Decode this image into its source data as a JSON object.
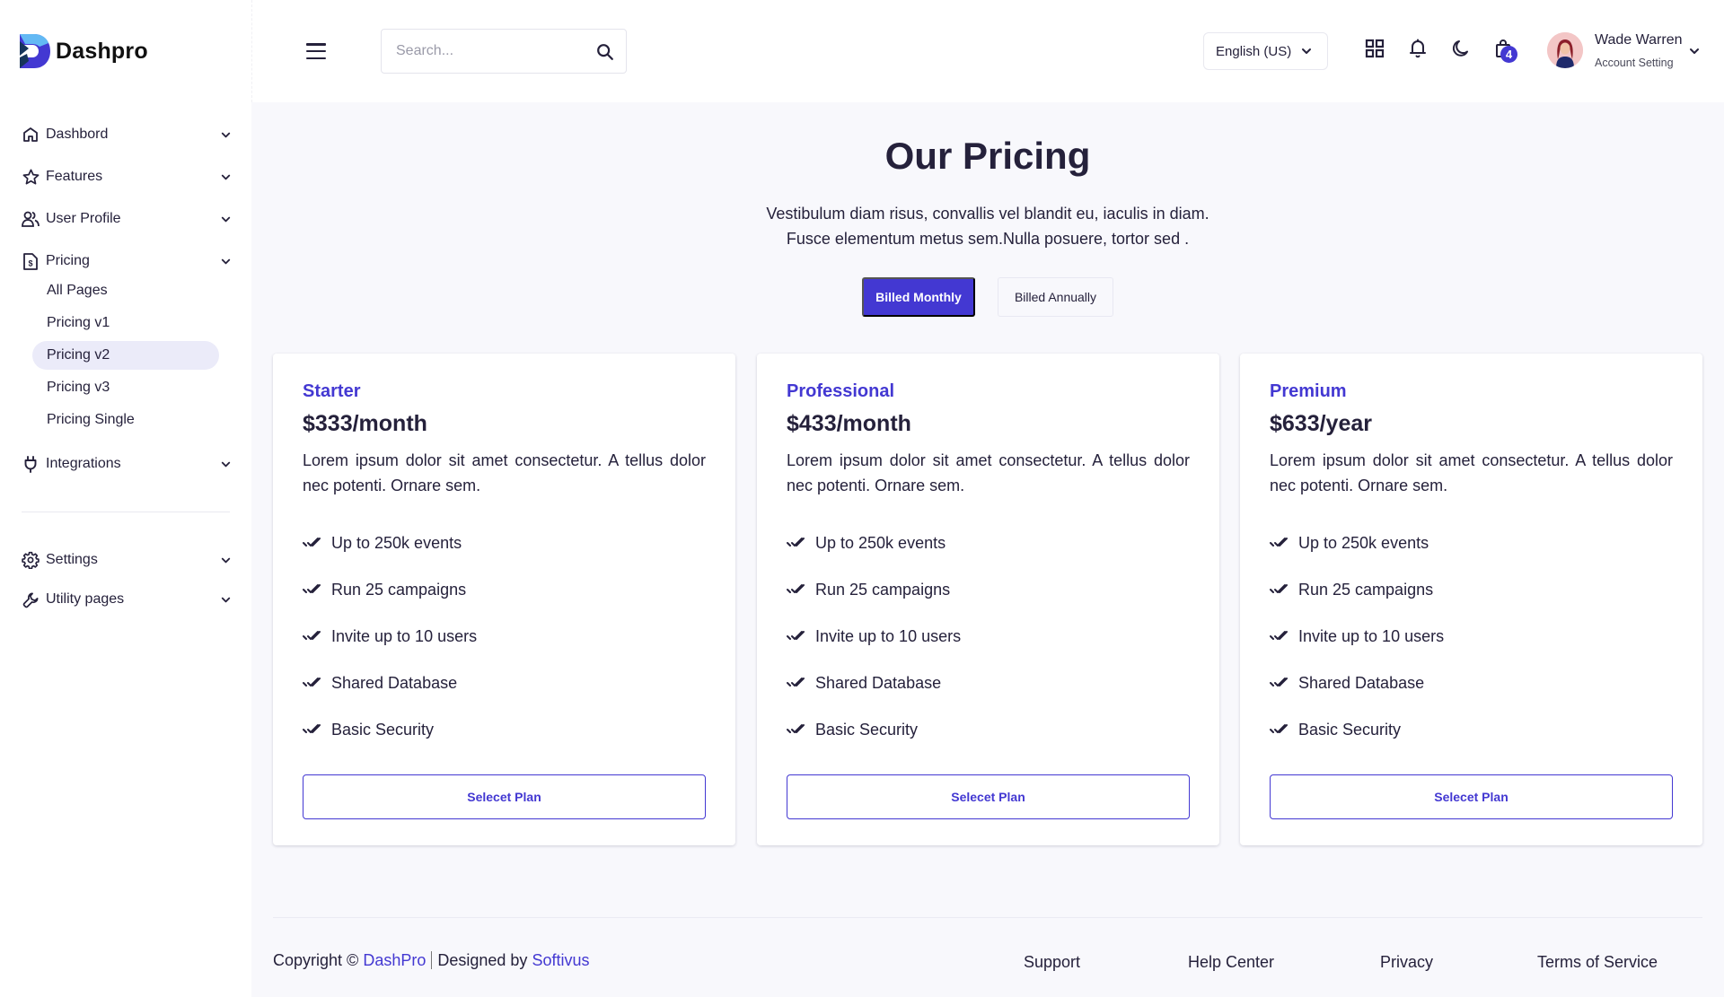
{
  "brand": {
    "name": "Dashpro"
  },
  "header": {
    "search_placeholder": "Search...",
    "search_value": "",
    "language": "English (US)",
    "cart_count": "4",
    "user": {
      "name": "Wade Warren",
      "subtitle": "Account Setting"
    },
    "icons": [
      "grid-icon",
      "bell-icon",
      "moon-icon",
      "shopping-bag-icon"
    ]
  },
  "sidebar": {
    "items": [
      {
        "label": "Dashbord",
        "icon": "home-icon"
      },
      {
        "label": "Features",
        "icon": "star-icon"
      },
      {
        "label": "User Profile",
        "icon": "users-icon"
      },
      {
        "label": "Pricing",
        "icon": "invoice-icon",
        "expanded": true
      },
      {
        "label": "Integrations",
        "icon": "plug-icon"
      },
      {
        "label": "Settings",
        "icon": "gear-icon"
      },
      {
        "label": "Utility pages",
        "icon": "wrench-icon"
      }
    ],
    "pricing_sub": [
      {
        "label": "All Pages"
      },
      {
        "label": "Pricing v1"
      },
      {
        "label": "Pricing v2",
        "active": true
      },
      {
        "label": "Pricing v3"
      },
      {
        "label": "Pricing Single"
      }
    ]
  },
  "main": {
    "title": "Our Pricing",
    "subtitle_line1": "Vestibulum diam risus, convallis vel blandit eu, iaculis in diam.",
    "subtitle_line2": "Fusce elementum metus sem.Nulla posuere, tortor sed .",
    "billing": {
      "monthly": "Billed Monthly",
      "annually": "Billed Annually",
      "selected": "monthly"
    },
    "plans": [
      {
        "name": "Starter",
        "price": "$333/month",
        "description": "Lorem ipsum dolor sit amet consectetur. A tellus dolor nec potenti. Ornare sem.",
        "features": [
          "Up to 250k events",
          "Run 25 campaigns",
          "Invite up to 10 users",
          "Shared Database",
          "Basic Security"
        ],
        "button": "Selecet Plan"
      },
      {
        "name": "Professional",
        "price": "$433/month",
        "description": "Lorem ipsum dolor sit amet consectetur. A tellus dolor nec potenti. Ornare sem.",
        "features": [
          "Up to 250k events",
          "Run 25 campaigns",
          "Invite up to 10 users",
          "Shared Database",
          "Basic Security"
        ],
        "button": "Selecet Plan"
      },
      {
        "name": "Premium",
        "price": "$633/year",
        "description": "Lorem ipsum dolor sit amet consectetur. A tellus dolor nec potenti. Ornare sem.",
        "features": [
          "Up to 250k events",
          "Run 25 campaigns",
          "Invite up to 10 users",
          "Shared Database",
          "Basic Security"
        ],
        "button": "Selecet Plan"
      }
    ]
  },
  "footer": {
    "copyright_prefix": "Copyright ©",
    "brand_link": "DashPro",
    "designed_by": "Designed by",
    "designer_link": "Softivus",
    "links": [
      "Support",
      "Help Center",
      "Privacy",
      "Terms of Service"
    ]
  },
  "colors": {
    "accent": "#4338d2",
    "text": "#25213b",
    "background": "#f8f8fc",
    "active_sub_bg": "#ebebf9"
  }
}
